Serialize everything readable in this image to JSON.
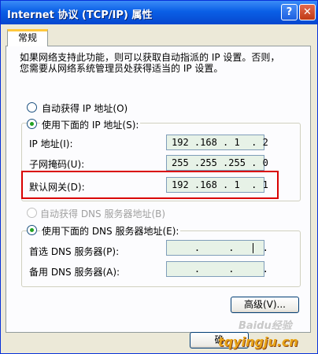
{
  "window": {
    "title": "Internet 协议 (TCP/IP) 属性",
    "help_btn": "?",
    "close_btn": "✕"
  },
  "tab": "常规",
  "intro": "如果网络支持此功能，则可以获取自动指派的 IP 设置。否则，\n您需要从网络系统管理员处获得适当的 IP 设置。",
  "ip": {
    "auto_label": "自动获得 IP 地址(O)",
    "manual_label": "使用下面的 IP 地址(S):",
    "fields": [
      {
        "label": "IP 地址(I):",
        "value": "192 .168 . 1  . 2"
      },
      {
        "label": "子网掩码(U):",
        "value": "255 .255 .255 . 0"
      },
      {
        "label": "默认网关(D):",
        "value": "192 .168 . 1  . 1"
      }
    ]
  },
  "dns": {
    "auto_label": "自动获得 DNS 服务器地址(B)",
    "manual_label": "使用下面的 DNS 服务器地址(E):",
    "fields": [
      {
        "label": "首选 DNS 服务器(P):",
        "value": "    .     .     ."
      },
      {
        "label": "备用 DNS 服务器(A):",
        "value": "    .     .     ."
      }
    ]
  },
  "buttons": {
    "advanced": "高级(V)...",
    "ok": "确"
  },
  "watermark": {
    "baidu": "Baidu经验",
    "site": "tqyingju.cn"
  },
  "colors": {
    "highlight_border": "#D90000",
    "field_bg": "#E7F2E7"
  }
}
